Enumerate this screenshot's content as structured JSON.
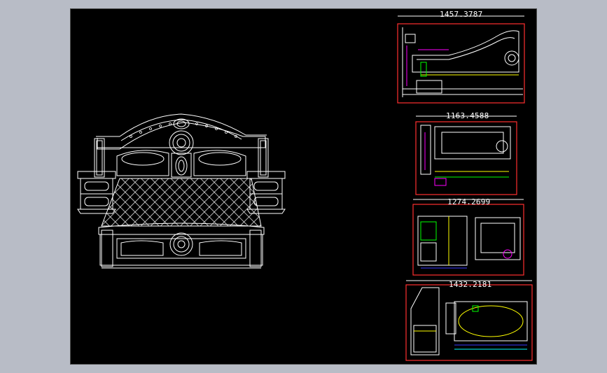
{
  "viewport": {
    "background_color": "#b8bcc6",
    "sheet_color": "#000000"
  },
  "palette": {
    "frame": "#ff3030",
    "line": "#ffffff",
    "accent_yellow": "#ffff00",
    "accent_green": "#00ff00",
    "accent_magenta": "#ff00ff",
    "accent_cyan": "#00ffff",
    "accent_blue": "#3a3aff"
  },
  "dimensions": {
    "view1": "1457.3787",
    "view2": "1163.4588",
    "view3": "1274.2699",
    "view4": "1432.2181"
  },
  "main_drawing": {
    "icon": "bed-elevation-drawing"
  }
}
